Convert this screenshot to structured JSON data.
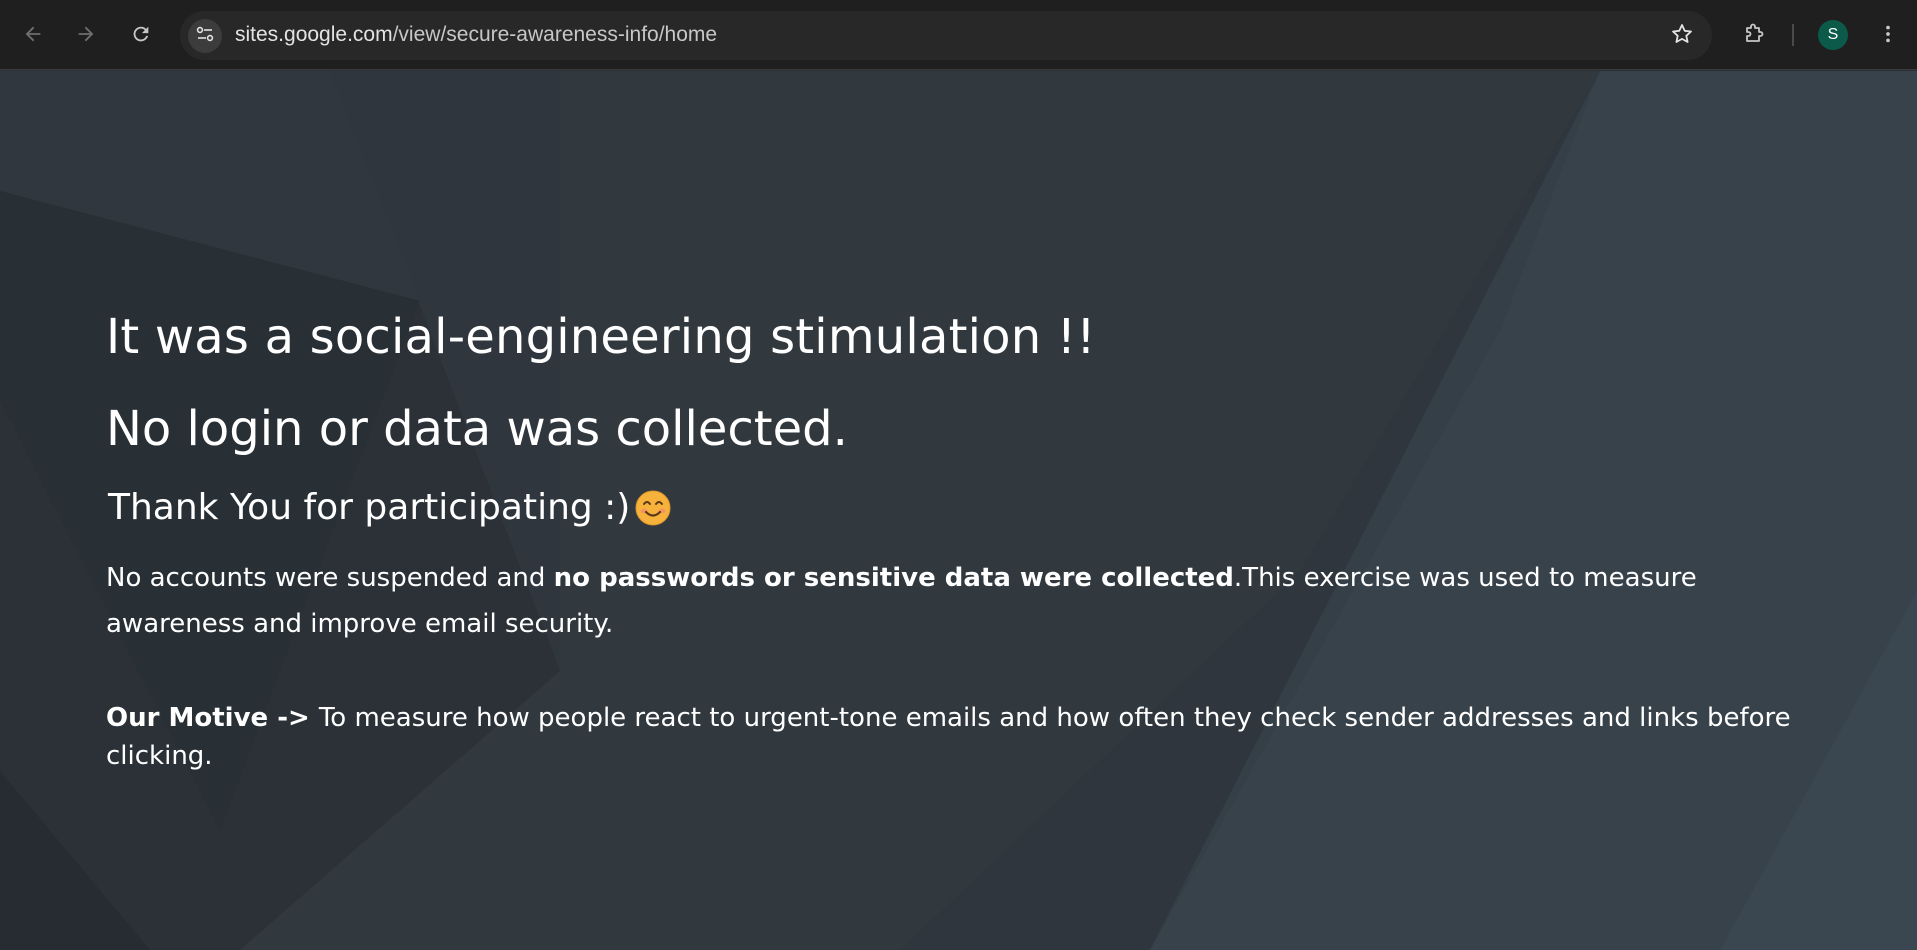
{
  "browser": {
    "url_host": "sites.google.com",
    "url_path": "/view/secure-awareness-info/home",
    "profile_initial": "S",
    "icons": {
      "back": "back-arrow-icon",
      "forward": "forward-arrow-icon",
      "reload": "reload-icon",
      "site_info": "tune-icon",
      "bookmark": "star-icon",
      "extensions": "puzzle-icon",
      "menu": "kebab-menu-icon"
    }
  },
  "page": {
    "heading_line1": "It was a social-engineering stimulation !!",
    "heading_line2": "No login or data was collected.",
    "thank_you": "Thank You for participating :)",
    "thank_you_emoji": "smiling-face-icon",
    "paragraph1": {
      "intro": "No accounts were suspended and ",
      "bold": "no passwords or sensitive data were collected",
      "rest": ".This exercise was used to measure awareness and improve email security."
    },
    "paragraph2": {
      "label": "Our Motive -> ",
      "text": "To measure how people react to urgent-tone emails and how often they check sender addresses and links before clicking."
    }
  },
  "colors": {
    "toolbar_bg": "#1f1f1f",
    "omnibox_bg": "#282828",
    "page_bg": "#2e353c",
    "text": "#ffffff",
    "avatar_bg": "#0b5a4a"
  }
}
